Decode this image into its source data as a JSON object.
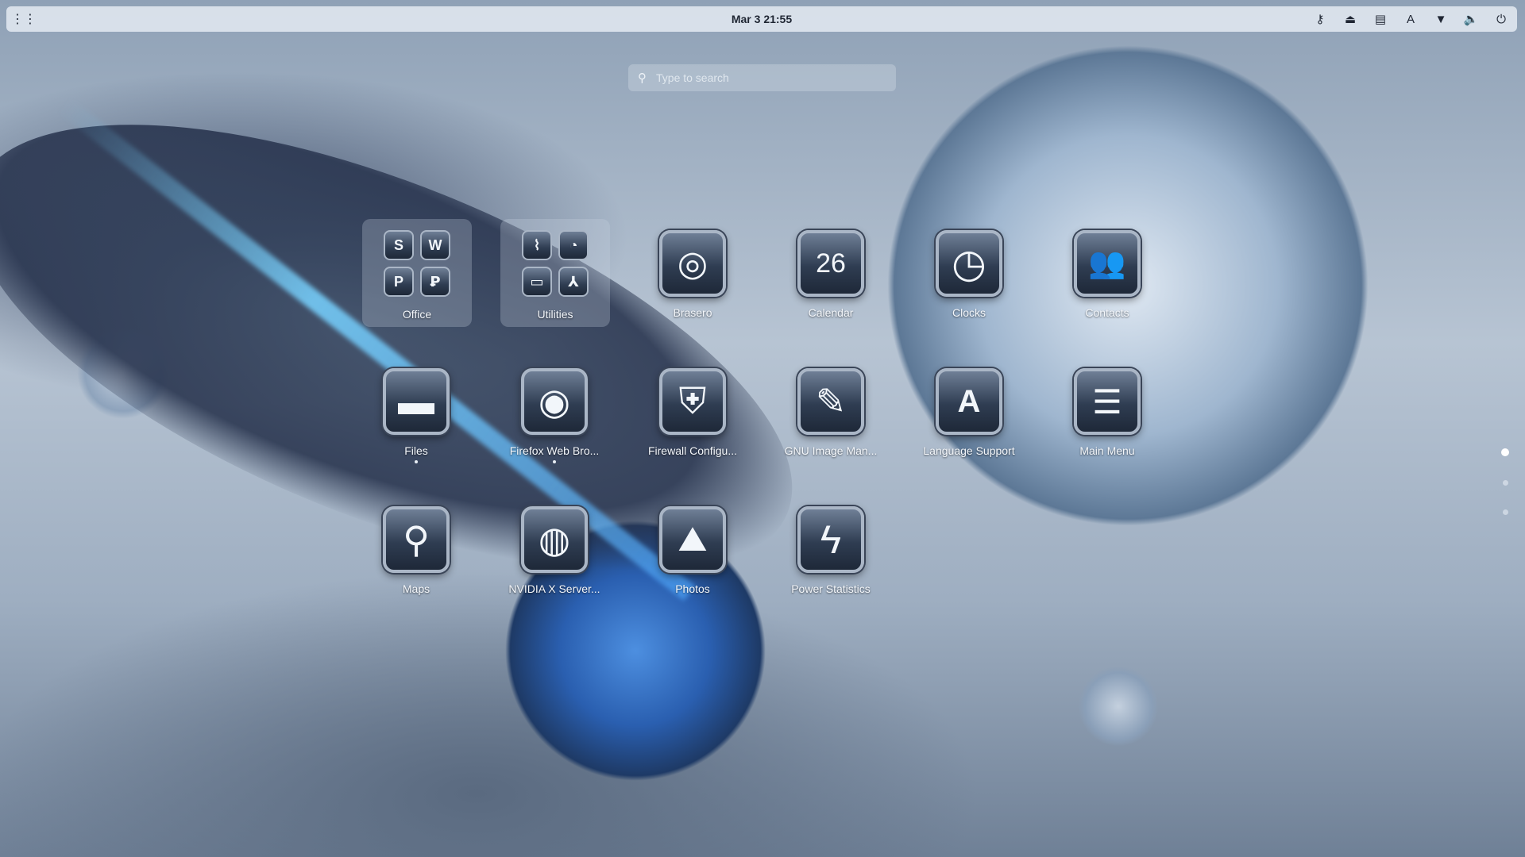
{
  "topbar": {
    "clock": "Mar 3  21:55",
    "tray": [
      {
        "name": "key-icon",
        "glyph": "⚷"
      },
      {
        "name": "eject-icon",
        "glyph": "⏏"
      },
      {
        "name": "notes-icon",
        "glyph": "▤"
      },
      {
        "name": "keyboard-layout-icon",
        "glyph": "A"
      },
      {
        "name": "wifi-icon",
        "glyph": "▼"
      },
      {
        "name": "volume-icon",
        "glyph": "🔈"
      },
      {
        "name": "power-icon",
        "glyph": "⏻"
      }
    ]
  },
  "search": {
    "placeholder": "Type to search"
  },
  "folders": [
    {
      "label": "Office",
      "glyphs": [
        "S",
        "W",
        "P",
        "Ꝑ"
      ]
    },
    {
      "label": "Utilities",
      "glyphs": [
        "⌇",
        "◔",
        "▭",
        "⅄"
      ]
    }
  ],
  "apps": [
    {
      "label": "Brasero",
      "icon": "disc-burner-icon",
      "glyph": "◎"
    },
    {
      "label": "Calendar",
      "icon": "calendar-icon",
      "glyph": "26"
    },
    {
      "label": "Clocks",
      "icon": "clock-icon",
      "glyph": "◷"
    },
    {
      "label": "Contacts",
      "icon": "contacts-icon",
      "glyph": "👥"
    },
    {
      "label": "Files",
      "icon": "folder-icon",
      "glyph": "▬"
    },
    {
      "label": "Firefox Web Bro...",
      "icon": "firefox-icon",
      "glyph": "◉"
    },
    {
      "label": "Firewall Configu...",
      "icon": "shield-icon",
      "glyph": "⛨"
    },
    {
      "label": "GNU Image Man...",
      "icon": "brush-icon",
      "glyph": "✎"
    },
    {
      "label": "Language Support",
      "icon": "language-icon",
      "glyph": "A"
    },
    {
      "label": "Main Menu",
      "icon": "menu-list-icon",
      "glyph": "☰"
    },
    {
      "label": "Maps",
      "icon": "map-pin-icon",
      "glyph": "⚲"
    },
    {
      "label": "NVIDIA X Server...",
      "icon": "nvidia-icon",
      "glyph": "◍"
    },
    {
      "label": "Photos",
      "icon": "photos-icon",
      "glyph": "⛰"
    },
    {
      "label": "Power Statistics",
      "icon": "lightning-icon",
      "glyph": "ϟ"
    }
  ]
}
